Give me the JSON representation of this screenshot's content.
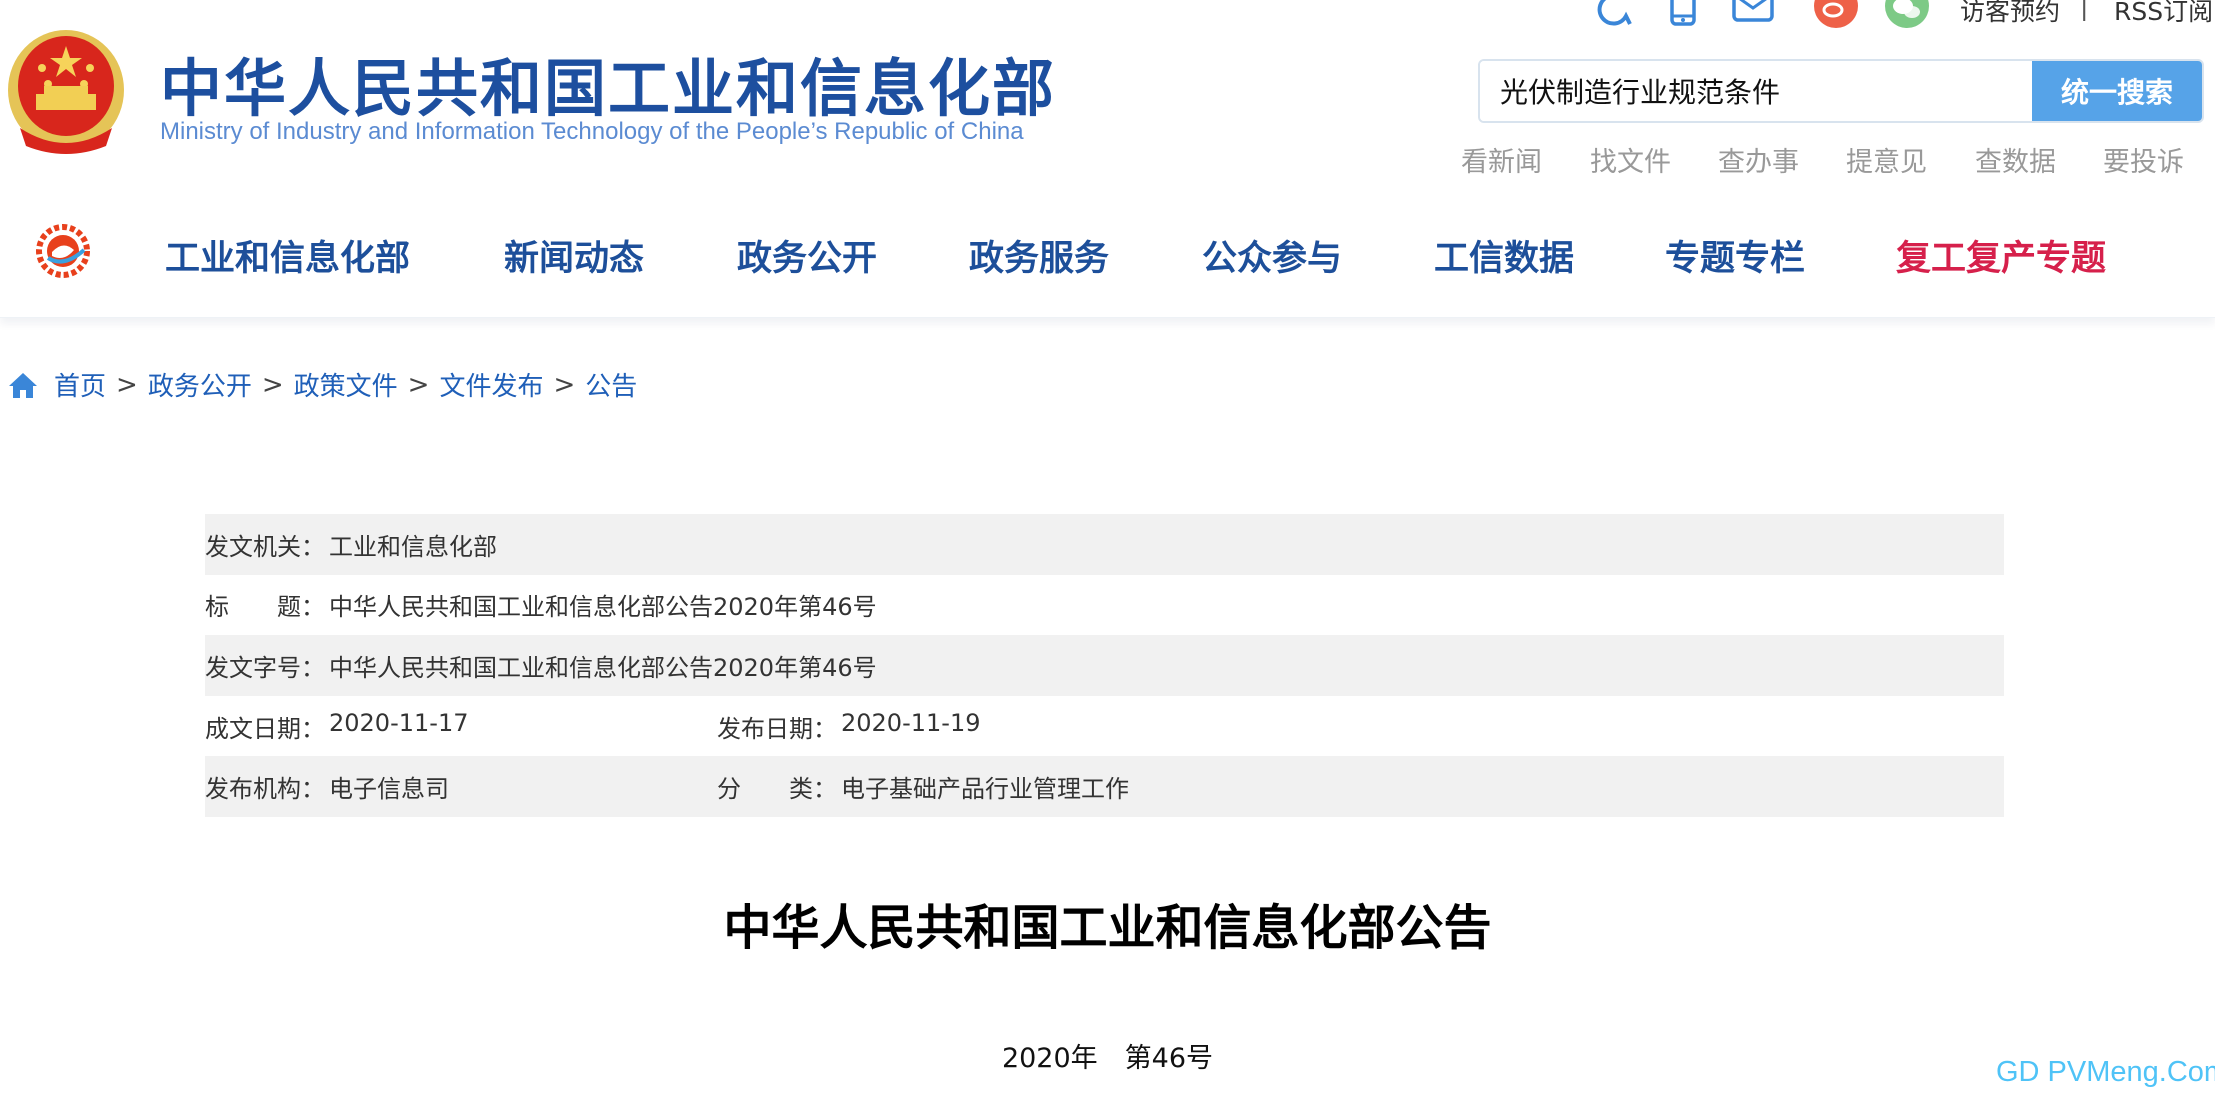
{
  "header": {
    "title": "中华人民共和国工业和信息化部",
    "subtitle": "Ministry of Industry and Information Technology of the People’s Republic of China",
    "top_icons": [
      "accessibility-icon",
      "mobile-icon",
      "mail-icon",
      "weibo-icon",
      "wechat-icon"
    ],
    "top_links": {
      "visit": "访客预约",
      "divider": "|",
      "rss": "RSS订阅"
    },
    "search": {
      "value": "光伏制造行业规范条件",
      "button": "统一搜索"
    },
    "quick_links": [
      "看新闻",
      "找文件",
      "查办事",
      "提意见",
      "查数据",
      "要投诉"
    ]
  },
  "nav": {
    "items": [
      {
        "label": "工业和信息化部"
      },
      {
        "label": "新闻动态"
      },
      {
        "label": "政务公开"
      },
      {
        "label": "政务服务"
      },
      {
        "label": "公众参与"
      },
      {
        "label": "工信数据"
      },
      {
        "label": "专题专栏"
      },
      {
        "label": "复工复产专题",
        "color": "#d6204b"
      }
    ],
    "color": "#1d4f9a"
  },
  "breadcrumb": {
    "sep": ">",
    "items": [
      "首页",
      "政务公开",
      "政策文件",
      "文件发布",
      "公告"
    ]
  },
  "meta": {
    "issuer_label": "发文机关：",
    "issuer": "工业和信息化部",
    "title_label": "标　　题：",
    "title": "中华人民共和国工业和信息化部公告2020年第46号",
    "docno_label": "发文字号：",
    "docno": "中华人民共和国工业和信息化部公告2020年第46号",
    "written_label": "成文日期：",
    "written": "2020-11-17",
    "published_label": "发布日期：",
    "published": "2020-11-19",
    "org_label": "发布机构：",
    "org": "电子信息司",
    "category_label": "分　　类：",
    "category": "电子基础产品行业管理工作"
  },
  "document": {
    "heading": "中华人民共和国工业和信息化部公告",
    "number": "2020年　第46号"
  },
  "watermark": "GD PVMeng.Com"
}
